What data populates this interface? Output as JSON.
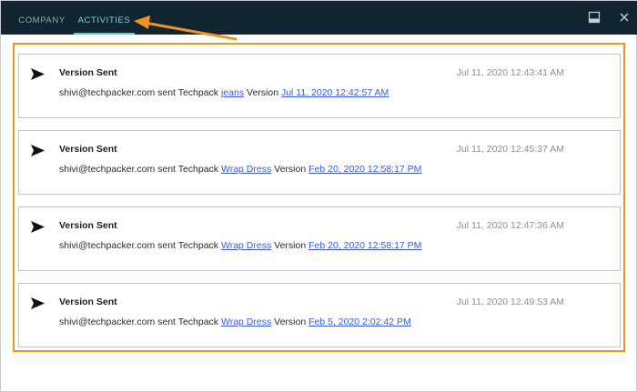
{
  "tabs": [
    {
      "label": "COMPANY"
    },
    {
      "label": "ACTIVITIES"
    }
  ],
  "active_tab": "ACTIVITIES",
  "colors": {
    "header_bg": "#10252f",
    "active_tab": "#7fd6e0",
    "highlight": "#f0931f",
    "link": "#3a5ad9"
  },
  "activities": [
    {
      "title": "Version Sent",
      "time": "Jul 11, 2020 12:43:41 AM",
      "actor": "shivi@techpacker.com",
      "action_text": "sent Techpack",
      "techpack": "jeans",
      "version_word": "Version",
      "version": "Jul 11, 2020 12:42:57 AM"
    },
    {
      "title": "Version Sent",
      "time": "Jul 11, 2020 12:45:37 AM",
      "actor": "shivi@techpacker.com",
      "action_text": "sent Techpack",
      "techpack": "Wrap Dress",
      "version_word": "Version",
      "version": "Feb 20, 2020 12:58:17 PM"
    },
    {
      "title": "Version Sent",
      "time": "Jul 11, 2020 12:47:36 AM",
      "actor": "shivi@techpacker.com",
      "action_text": "sent Techpack",
      "techpack": "Wrap Dress",
      "version_word": "Version",
      "version": "Feb 20, 2020 12:58:17 PM"
    },
    {
      "title": "Version Sent",
      "time": "Jul 11, 2020 12:49:53 AM",
      "actor": "shivi@techpacker.com",
      "action_text": "sent Techpack",
      "techpack": "Wrap Dress",
      "version_word": "Version",
      "version": "Feb 5, 2020 2:02:42 PM"
    }
  ]
}
